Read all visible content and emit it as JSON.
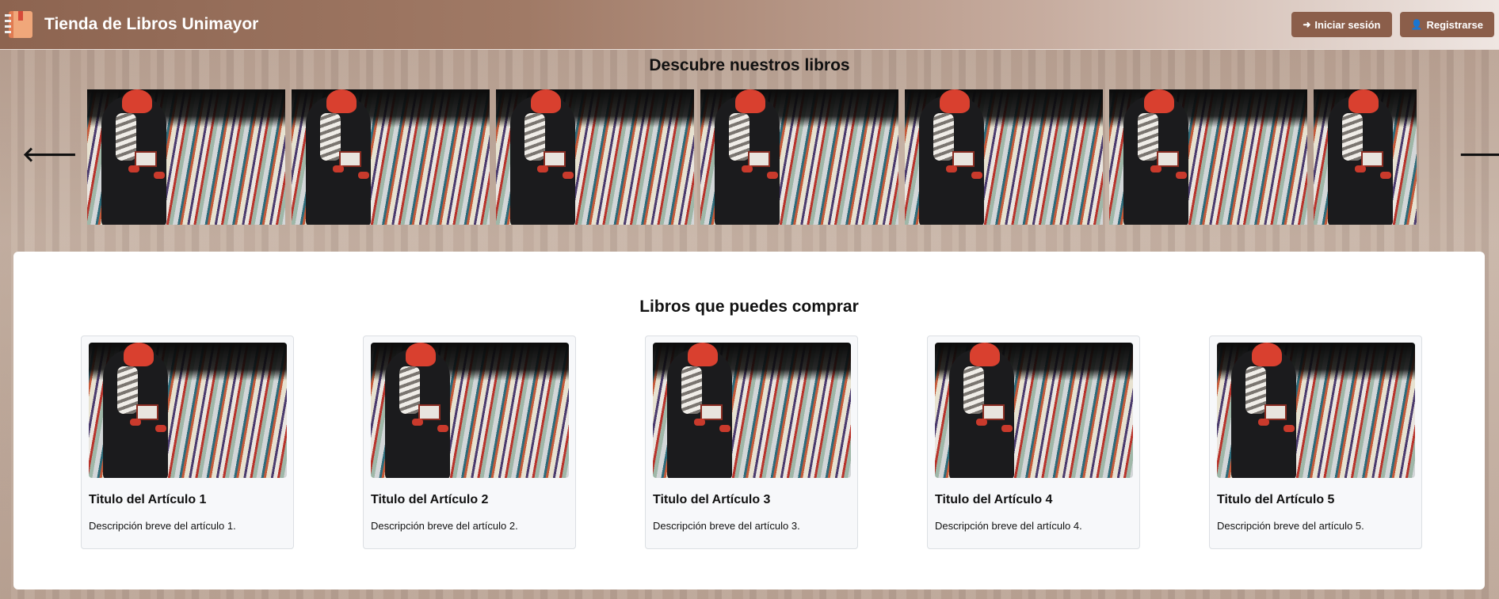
{
  "header": {
    "brand": "Tienda de Libros Unimayor",
    "logo_icon": "book-logo-icon",
    "login_label": "Iniciar sesión",
    "login_icon": "sign-in-icon",
    "register_label": "Registrarse",
    "register_icon": "user-plus-icon"
  },
  "carousel": {
    "title": "Descubre nuestros libros",
    "prev_icon": "arrow-left-icon",
    "next_icon": "arrow-right-icon",
    "prev_glyph": "🡐",
    "next_glyph": "🡒",
    "slide_count": 7
  },
  "catalog": {
    "title": "Libros que puedes comprar",
    "items": [
      {
        "title": "Titulo del Artículo 1",
        "description": "Descripción breve del artículo 1."
      },
      {
        "title": "Titulo del Artículo 2",
        "description": "Descripción breve del artículo 2."
      },
      {
        "title": "Titulo del Artículo 3",
        "description": "Descripción breve del artículo 3."
      },
      {
        "title": "Titulo del Artículo 4",
        "description": "Descripción breve del artículo 4."
      },
      {
        "title": "Titulo del Artículo 5",
        "description": "Descripción breve del artículo 5."
      }
    ]
  },
  "colors": {
    "button_bg": "#8b5e4a",
    "header_start": "#8d6450",
    "header_end": "#efe6e2"
  }
}
